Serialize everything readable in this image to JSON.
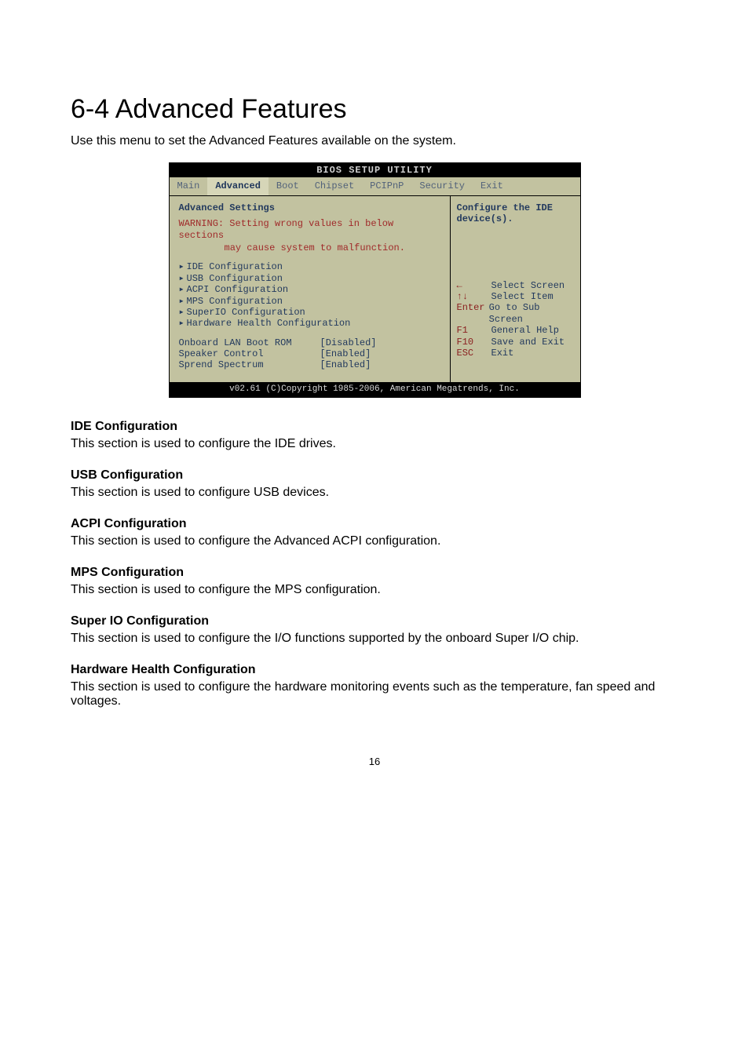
{
  "heading": "6-4 Advanced Features",
  "intro": "Use this menu to set the Advanced Features available on the system.",
  "bios": {
    "title": "BIOS SETUP UTILITY",
    "tabs": [
      "Main",
      "Advanced",
      "Boot",
      "Chipset",
      "PCIPnP",
      "Security",
      "Exit"
    ],
    "active_tab": "Advanced",
    "panel_title": "Advanced Settings",
    "warning1": "WARNING: Setting wrong values in below sections",
    "warning2": "may cause system to malfunction.",
    "menu": [
      "IDE Configuration",
      "USB Configuration",
      "ACPI Configuration",
      "MPS Configuration",
      "SuperIO Configuration",
      "Hardware Health Configuration"
    ],
    "selected_menu_index": 0,
    "settings": [
      {
        "label": "Onboard LAN Boot ROM",
        "value": "[Disabled]"
      },
      {
        "label": "Speaker Control",
        "value": "[Enabled]"
      },
      {
        "label": "Sprend Spectrum",
        "value": "[Enabled]"
      }
    ],
    "help_title": "Configure the IDE",
    "help_sub": "device(s).",
    "help_keys": [
      {
        "k": "←",
        "v": "Select Screen"
      },
      {
        "k": "↑↓",
        "v": "Select Item"
      },
      {
        "k": "Enter",
        "v": "Go to Sub Screen"
      },
      {
        "k": "F1",
        "v": "General Help"
      },
      {
        "k": "F10",
        "v": "Save and Exit"
      },
      {
        "k": "ESC",
        "v": "Exit"
      }
    ],
    "footer": "v02.61 (C)Copyright 1985-2006, American Megatrends, Inc."
  },
  "sections": [
    {
      "h": "IDE Configuration",
      "t": "This section is used to configure the IDE drives."
    },
    {
      "h": "USB Configuration",
      "t": "This section is used to configure USB devices."
    },
    {
      "h": "ACPI Configuration",
      "t": "This section is used to configure the Advanced ACPI configuration."
    },
    {
      "h": "MPS Configuration",
      "t": "This section is used to configure the MPS configuration."
    },
    {
      "h": "Super IO Configuration",
      "t": "This section is used to configure the I/O functions supported by the onboard Super I/O chip."
    },
    {
      "h": "Hardware Health Configuration",
      "t": "This section is used to configure the hardware monitoring events such as the temperature, fan speed and voltages."
    }
  ],
  "page_number": "16"
}
